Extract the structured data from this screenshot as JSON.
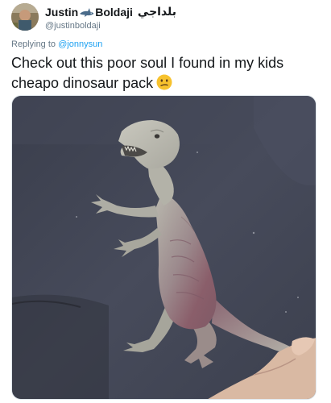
{
  "author": {
    "name_part1": "Justin",
    "name_part2": "Boldaji",
    "arabic_name": "بلداجي",
    "handle": "@justinboldaji",
    "name_icon": "shark-icon"
  },
  "reply": {
    "prefix": "Replying to",
    "mention": "@jonnysun"
  },
  "tweet": {
    "text": "Check out this poor soul I found in my kids cheapo dinosaur pack",
    "emoji": "confused-face-emoji"
  },
  "colors": {
    "link": "#1da1f2",
    "secondary_text": "#657786",
    "primary_text": "#14171a",
    "emoji_face": "#f7c22e"
  }
}
